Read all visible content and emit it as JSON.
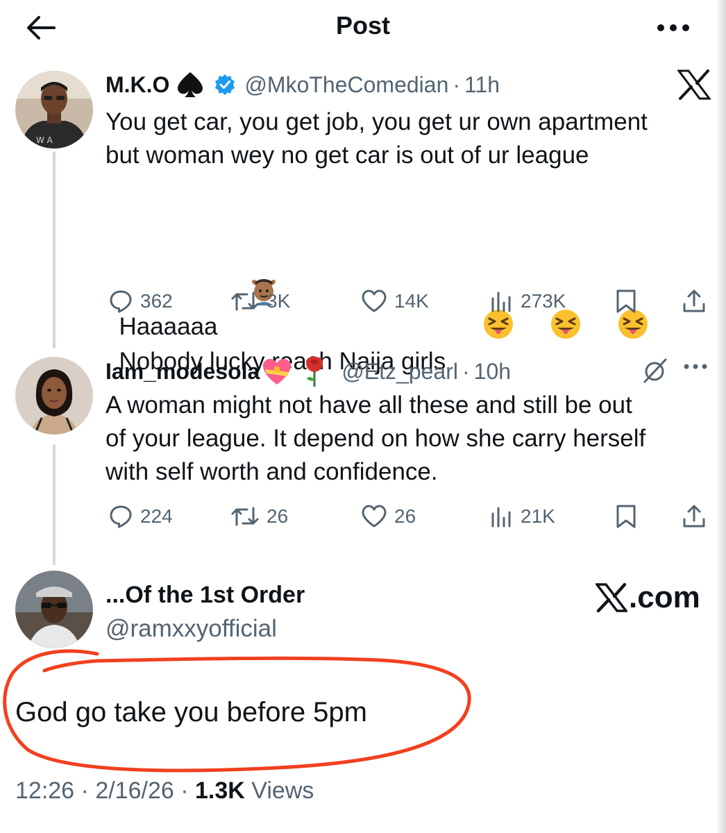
{
  "header": {
    "title": "Post"
  },
  "colors": {
    "text_primary": "#0f1419",
    "text_secondary": "#536471",
    "verified_blue": "#1d9bf0",
    "annotation_red": "#f2401e",
    "thread_line": "#cfd9de"
  },
  "posts": [
    {
      "display_name": "M.K.O",
      "name_badge_icon": "spade-icon",
      "verified": true,
      "handle": "@MkoTheComedian",
      "separator": "·",
      "time": "11h",
      "corner_icon": "x-logo-icon",
      "text_lines": [
        "You get car, you get job, you get ur own apartment",
        "but woman wey no get car is out of ur league",
        "",
        "Haaaaaa",
        "Nobody lucky reach Naija girls"
      ],
      "inline_emojis": [
        "person-gesturing-no-emoji",
        "squinting-tongue-emoji",
        "squinting-tongue-emoji",
        "squinting-tongue-emoji"
      ],
      "stats": {
        "replies": "362",
        "reposts": "3K",
        "likes": "14K",
        "views": "273K"
      }
    },
    {
      "display_name": "Iam_modesola",
      "name_badge_icons": [
        "heart-with-ribbon-emoji",
        "rose-emoji"
      ],
      "handle": "@Etz_pearl",
      "separator": "·",
      "time": "10h",
      "corner_icons": [
        "grok-icon",
        "more-icon"
      ],
      "text_lines": [
        "A woman might not have all these and still be out",
        "of your league. It depend on how she carry herself",
        "with self worth and confidence."
      ],
      "stats": {
        "replies": "224",
        "reposts": "26",
        "likes": "26",
        "views": "21K"
      }
    }
  ],
  "focus_post": {
    "display_name": "...Of the 1st Order",
    "handle": "@ramxxyofficial",
    "text": "God go take you before 5pm",
    "time": "12:26",
    "date": "2/16/26",
    "separator": "·",
    "views_count": "1.3K",
    "views_label": "Views"
  },
  "watermark": {
    "text": ".com"
  }
}
